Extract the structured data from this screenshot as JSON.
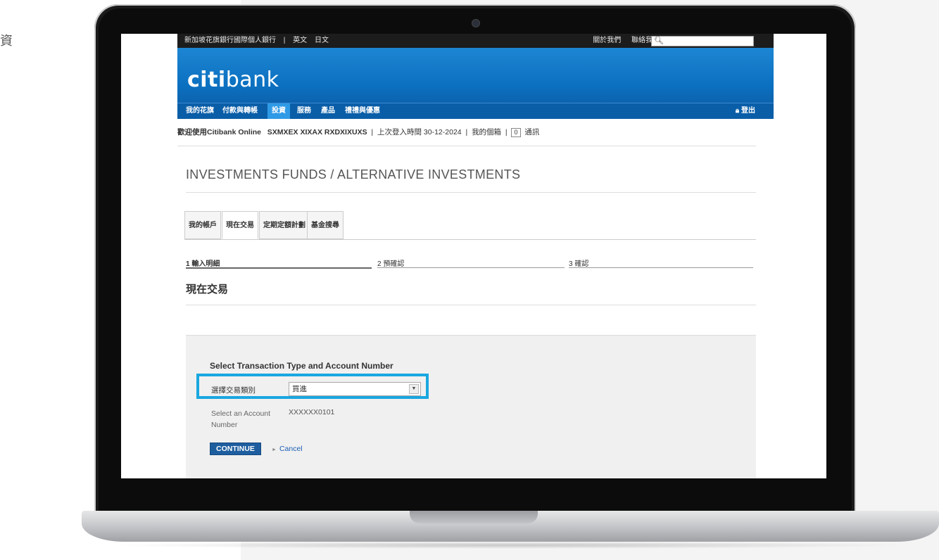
{
  "edge_char": "資",
  "topbar": {
    "left_items": [
      "新加坡花旗銀行國際個人銀行",
      "|",
      "英文",
      "日文"
    ],
    "right_items": [
      "關於我們",
      "聯絡我們"
    ],
    "search_icon": "search-icon"
  },
  "brand": {
    "logo_bold": "citi",
    "logo_light": "bank"
  },
  "nav": {
    "items": [
      "我的花旗",
      "付款與轉帳",
      "投資",
      "服務",
      "產品",
      "禮禮與優惠"
    ],
    "active_index": 2,
    "logout": "登出",
    "logout_icon": "lock-icon"
  },
  "welcome": {
    "prefix": "歡迎使用Citibank Online",
    "user": "SXMXEX XIXAX RXDXIXUXS",
    "sep1": "|",
    "last_login": "上次登入時間 30-12-2024",
    "sep2": "|",
    "mailbox": "我的個箱",
    "sep3": "|",
    "msg_count": "0",
    "msg_label": "通訊"
  },
  "page_title": "INVESTMENTS FUNDS / ALTERNATIVE INVESTMENTS",
  "tabs": [
    "我的帳戶",
    "現在交易",
    "定期定額計劃",
    "基金搜尋"
  ],
  "active_tab": 1,
  "steps": [
    "1 輸入明細",
    "2 預確認",
    "3 確認"
  ],
  "section_title": "現在交易",
  "form": {
    "heading": "Select Transaction Type and Account Number",
    "type_label": "選擇交易類別",
    "type_value": "買進",
    "account_label": "Select an Account Number",
    "account_value": "XXXXXX0101",
    "continue_label": "CONTINUE",
    "cancel_label": "Cancel"
  },
  "colors": {
    "brand_blue": "#0b6fbf",
    "nav_active": "#2f9ae6",
    "highlight": "#1aa7e0",
    "button": "#1e5e9f"
  }
}
